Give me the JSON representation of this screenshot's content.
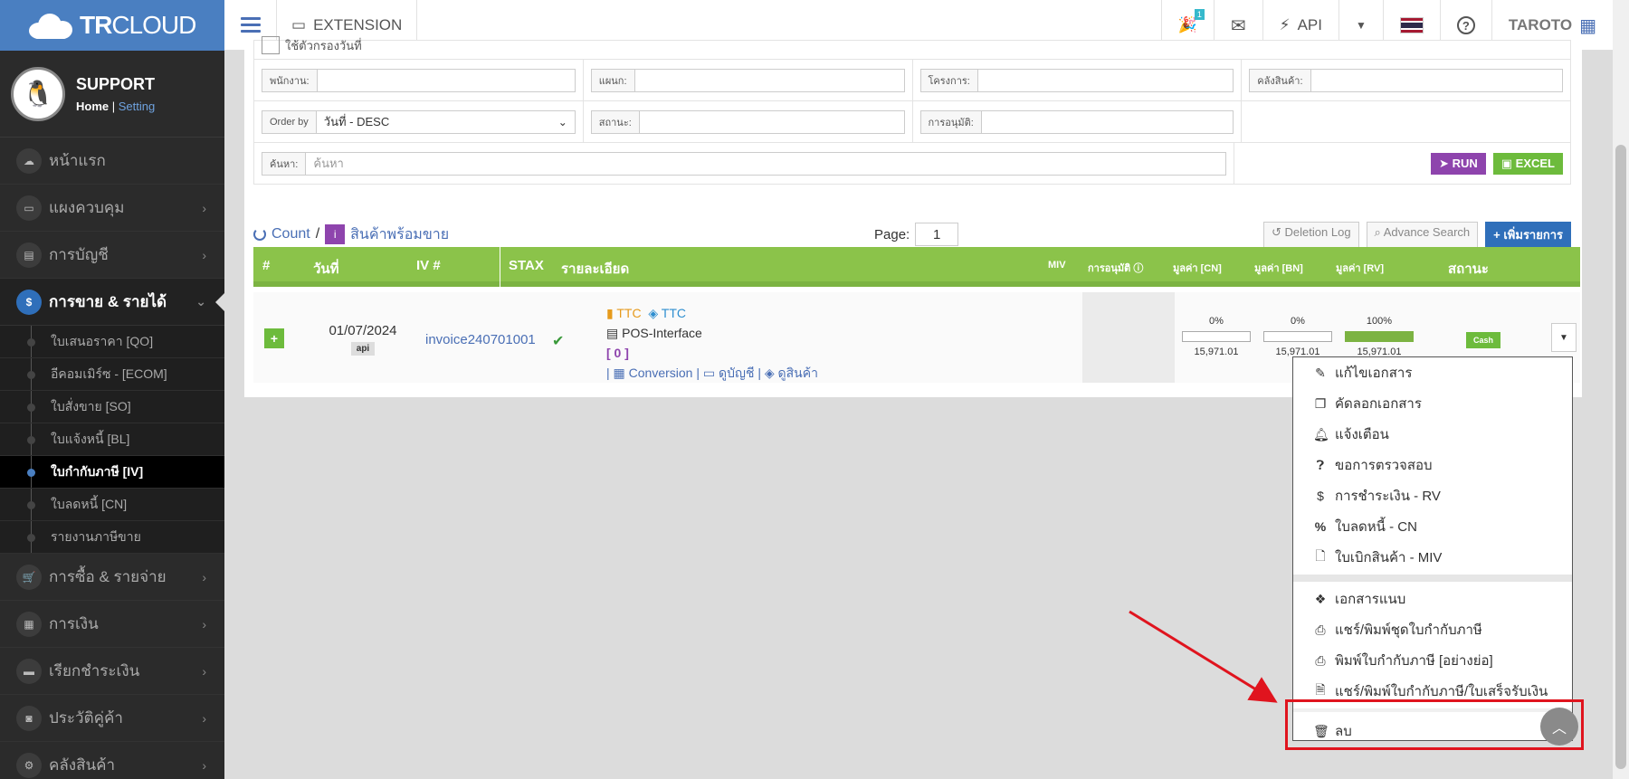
{
  "topbar": {
    "brand_tr": "TR",
    "brand_cloud": "CLOUD",
    "extension_label": "EXTENSION",
    "notif_count": "1",
    "api_label": "API",
    "user_label": "TAROTO"
  },
  "sidebar": {
    "profile_name": "SUPPORT",
    "home_label": "Home",
    "setting_label": "Setting",
    "items": [
      {
        "label": "หน้าแรก",
        "icon": "cloud-icon"
      },
      {
        "label": "แผงควบคุม",
        "icon": "monitor-icon"
      },
      {
        "label": "การบัญชี",
        "icon": "book-icon"
      },
      {
        "label": "การขาย & รายได้",
        "icon": "dollar-icon"
      },
      {
        "label": "การซื้อ & รายจ่าย",
        "icon": "cart-icon"
      },
      {
        "label": "การเงิน",
        "icon": "calendar-icon"
      },
      {
        "label": "เรียกชำระเงิน",
        "icon": "card-icon"
      },
      {
        "label": "ประวัติคู่ค้า",
        "icon": "contact-icon"
      },
      {
        "label": "คลังสินค้า",
        "icon": "warehouse-icon"
      }
    ],
    "sub_items": [
      "ใบเสนอราคา [QO]",
      "อีคอมเมิร์ซ - [ECOM]",
      "ใบสั่งขาย [SO]",
      "ใบแจ้งหนี้ [BL]",
      "ใบกำกับภาษี [IV]",
      "ใบลดหนี้ [CN]",
      "รายงานภาษีขาย"
    ]
  },
  "filters": {
    "top_cut_text": "ใช้ตัวกรองวันที่",
    "employee_label": "พนักงาน:",
    "dept_label": "แผนก:",
    "project_label": "โครงการ:",
    "warehouse_label": "คลังสินค้า:",
    "orderby_label": "Order by",
    "orderby_value": "วันที่ - DESC",
    "status_label": "สถานะ:",
    "approval_label": "การอนุมัติ:",
    "search_label": "ค้นหา:",
    "search_placeholder": "ค้นหา",
    "run_label": "RUN",
    "excel_label": "EXCEL"
  },
  "toolbar": {
    "count_label": "Count",
    "separator": "/",
    "filter_label": "สินค้าพร้อมขาย",
    "page_label": "Page:",
    "page_value": "1",
    "deletion_log": "Deletion Log",
    "advance_search": "Advance Search",
    "add_item": "เพิ่มรายการ"
  },
  "table": {
    "headers": {
      "num": "#",
      "date": "วันที่",
      "iv": "IV #",
      "stax": "STAX",
      "detail": "รายละเอียด",
      "miv": "MIV",
      "approval": "การอนุมัติ",
      "cn": "มูลค่า [CN]",
      "bn": "มูลค่า [BN]",
      "rv": "มูลค่า [RV]",
      "status": "สถานะ"
    },
    "row": {
      "date": "01/07/2024",
      "api_badge": "api",
      "invoice": "invoice240701001",
      "ttc1": "TTC",
      "ttc2": "TTC",
      "pos": "POS-Interface",
      "count_bracket": "[ 0 ]",
      "conversion": "Conversion",
      "view_account": "ดูบัญชี",
      "view_product": "ดูสินค้า",
      "cn_pct": "0%",
      "bn_pct": "0%",
      "rv_pct": "100%",
      "cn_val": "15,971.01",
      "bn_val": "15,971.01",
      "rv_val": "15,971.01",
      "status": "Cash"
    }
  },
  "dropdown": {
    "items": [
      {
        "label": "แก้ไขเอกสาร",
        "icon": "edit-icon"
      },
      {
        "label": "คัดลอกเอกสาร",
        "icon": "copy-icon"
      },
      {
        "label": "แจ้งเตือน",
        "icon": "bell-icon"
      },
      {
        "label": "ขอการตรวจสอบ",
        "icon": "question-icon"
      },
      {
        "label": "การชำระเงิน - RV",
        "icon": "dollar-icon"
      },
      {
        "label": "ใบลดหนี้ - CN",
        "icon": "percent-icon"
      },
      {
        "label": "ใบเบิกสินค้า - MIV",
        "icon": "file-icon"
      }
    ],
    "items2": [
      {
        "label": "เอกสารแนบ",
        "icon": "dropbox-icon"
      },
      {
        "label": "แชร์/พิมพ์ชุดใบกำกับภาษี",
        "icon": "print-icon"
      },
      {
        "label": "พิมพ์ใบกำกับภาษี [อย่างย่อ]",
        "icon": "print-icon"
      },
      {
        "label": "แชร์/พิมพ์ใบกำกับภาษี/ใบเสร็จรับเงิน",
        "icon": "pdf-icon"
      }
    ],
    "delete_label": "ลบ"
  },
  "colors": {
    "brand": "#4a7fc1",
    "table_header": "#8bc34a",
    "accent_purple": "#8e44ad",
    "highlight_red": "#e0141e"
  }
}
